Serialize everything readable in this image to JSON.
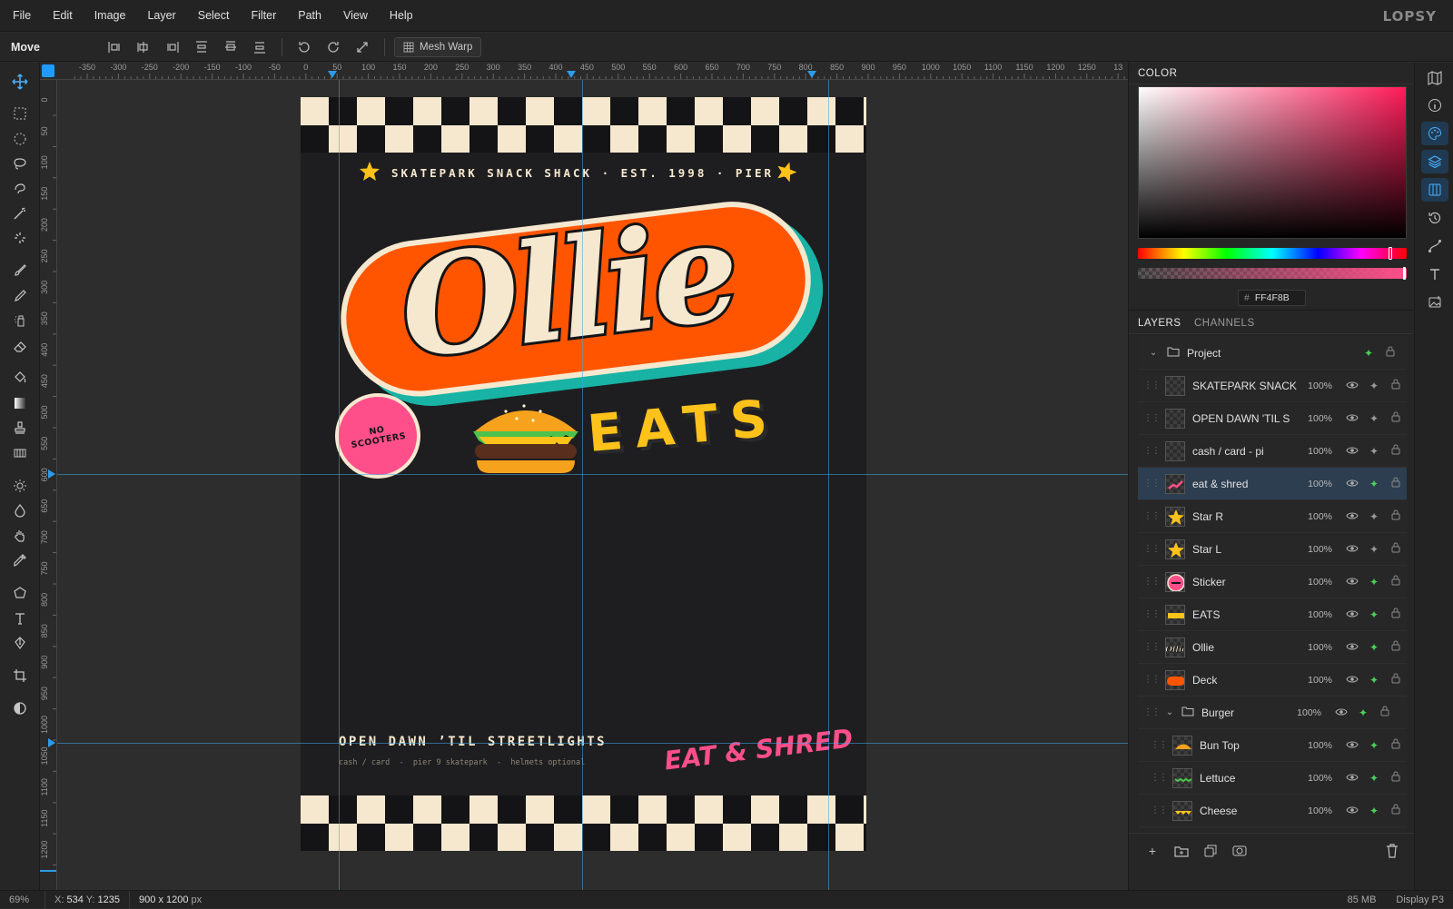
{
  "menu": [
    "File",
    "Edit",
    "Image",
    "Layer",
    "Select",
    "Filter",
    "Path",
    "View",
    "Help"
  ],
  "brand": "LOPSY",
  "options": {
    "tool_name": "Move",
    "mesh_warp": "Mesh Warp"
  },
  "ruler": {
    "top_labels": [
      "-350",
      "-300",
      "-250",
      "-200",
      "-150",
      "-100",
      "-50",
      "0",
      "50",
      "100",
      "150",
      "200",
      "250",
      "300",
      "350",
      "400",
      "450",
      "500",
      "550",
      "600",
      "650",
      "700",
      "750",
      "800",
      "850",
      "900",
      "950",
      "1000",
      "1050",
      "1100",
      "1150",
      "1200",
      "1250",
      "13"
    ],
    "left_labels": [
      "0",
      "50",
      "100",
      "150",
      "200",
      "250",
      "300",
      "350",
      "400",
      "450",
      "500",
      "550",
      "600",
      "650",
      "700",
      "750",
      "800",
      "850",
      "900",
      "950",
      "1000",
      "1050",
      "1100",
      "1150",
      "1200"
    ]
  },
  "poster": {
    "header_text": "SKATEPARK SNACK SHACK · EST. 1998 · PIER 9",
    "logo_word": "Ollie",
    "eats_word": "EATS",
    "sticker_line1": "NO",
    "sticker_line2": "SCOOTERS",
    "footer_headline": "OPEN DAWN ’TIL STREETLIGHTS",
    "footer_sub": "cash / card  -  pier 9 skatepark  -  helmets optional",
    "script_text": "EAT & SHRED",
    "colors": {
      "bg": "#1e1e20",
      "cream": "#f6e8cf",
      "orange": "#ff5500",
      "teal": "#18b3a4",
      "yellow": "#ffc21a",
      "pink": "#ff4f8b"
    }
  },
  "color_panel": {
    "tab": "COLOR",
    "hex_prefix": "#",
    "hex": "FF4F8B"
  },
  "layers_panel": {
    "tabs": [
      "LAYERS",
      "CHANNELS"
    ],
    "rows": [
      {
        "name": "Project",
        "group": true,
        "indent": 0,
        "opacity": ""
      },
      {
        "name": "SKATEPARK SNACK",
        "indent": 0,
        "opacity": "100%",
        "fx": false,
        "thumb": "text"
      },
      {
        "name": "OPEN DAWN 'TIL S",
        "indent": 0,
        "opacity": "100%",
        "fx": false,
        "thumb": "text"
      },
      {
        "name": "cash / card - pi",
        "indent": 0,
        "opacity": "100%",
        "fx": false,
        "thumb": "text"
      },
      {
        "name": "eat & shred",
        "indent": 0,
        "opacity": "100%",
        "fx": true,
        "selected": true,
        "thumb": "pink"
      },
      {
        "name": "Star R",
        "indent": 0,
        "opacity": "100%",
        "fx": false,
        "thumb": "star"
      },
      {
        "name": "Star L",
        "indent": 0,
        "opacity": "100%",
        "fx": false,
        "thumb": "star"
      },
      {
        "name": "Sticker",
        "indent": 0,
        "opacity": "100%",
        "fx": true,
        "thumb": "sticker"
      },
      {
        "name": "EATS",
        "indent": 0,
        "opacity": "100%",
        "fx": true,
        "thumb": "eats"
      },
      {
        "name": "Ollie",
        "indent": 0,
        "opacity": "100%",
        "fx": true,
        "thumb": "ollie"
      },
      {
        "name": "Deck",
        "indent": 0,
        "opacity": "100%",
        "fx": true,
        "thumb": "deck"
      },
      {
        "name": "Burger",
        "group": true,
        "indent": 1,
        "opacity": "100%",
        "fx": true
      },
      {
        "name": "Bun Top",
        "indent": 1,
        "opacity": "100%",
        "fx": true,
        "thumb": "bun"
      },
      {
        "name": "Lettuce",
        "indent": 1,
        "opacity": "100%",
        "fx": true,
        "thumb": "lettuce"
      },
      {
        "name": "Cheese",
        "indent": 1,
        "opacity": "100%",
        "fx": true,
        "thumb": "cheese"
      },
      {
        "name": "",
        "indent": 1,
        "opacity": "",
        "fx": false,
        "thumb": "empty"
      }
    ]
  },
  "status": {
    "zoom": "69%",
    "coords_label_x": "X:",
    "coords_x": "534",
    "coords_label_y": "Y:",
    "coords_y": "1235",
    "doc_size": "900 x 1200",
    "doc_unit": "px",
    "memory": "85 MB",
    "profile": "Display P3"
  }
}
